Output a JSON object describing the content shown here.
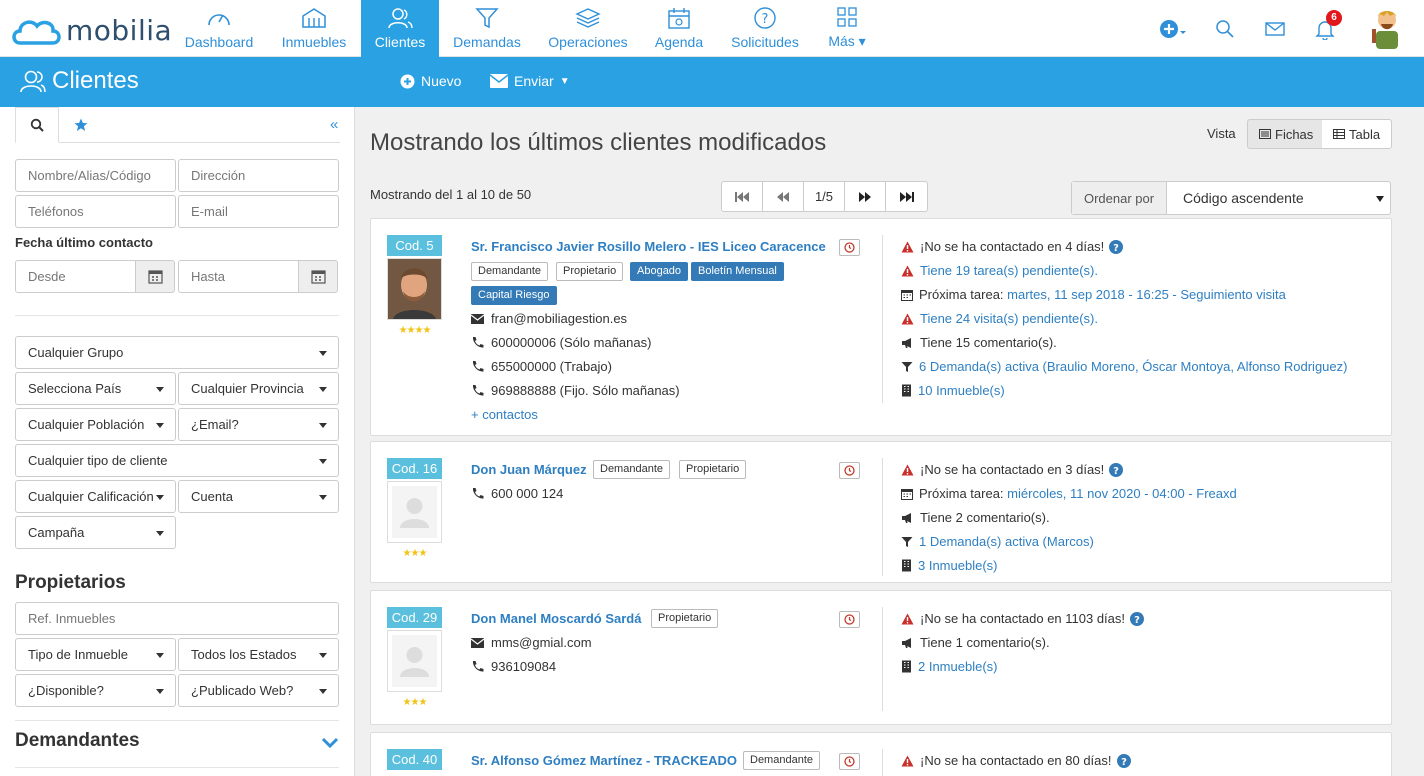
{
  "app": {
    "logo_text": "mobilia",
    "notification_count": "6"
  },
  "nav": [
    {
      "label": "Dashboard"
    },
    {
      "label": "Inmuebles"
    },
    {
      "label": "Clientes"
    },
    {
      "label": "Demandas"
    },
    {
      "label": "Operaciones"
    },
    {
      "label": "Agenda"
    },
    {
      "label": "Solicitudes"
    },
    {
      "label": "Más"
    }
  ],
  "header": {
    "title": "Clientes",
    "new_label": "Nuevo",
    "send_label": "Enviar"
  },
  "sidebar": {
    "name_placeholder": "Nombre/Alias/Código",
    "address_placeholder": "Dirección",
    "phones_placeholder": "Teléfonos",
    "email_placeholder": "E-mail",
    "last_contact_label": "Fecha último contacto",
    "from_placeholder": "Desde",
    "to_placeholder": "Hasta",
    "group": "Cualquier Grupo",
    "country": "Selecciona País",
    "province": "Cualquier Provincia",
    "town": "Cualquier Población",
    "email_q": "¿Email?",
    "client_type": "Cualquier tipo de cliente",
    "rating": "Cualquier Calificación",
    "account": "Cuenta",
    "campaign": "Campaña",
    "owners_title": "Propietarios",
    "ref_placeholder": "Ref. Inmuebles",
    "property_type": "Tipo de Inmueble",
    "states": "Todos los Estados",
    "available": "¿Disponible?",
    "published": "¿Publicado Web?",
    "demanders_title": "Demandantes"
  },
  "main": {
    "title": "Mostrando los últimos clientes modificados",
    "vista_label": "Vista",
    "view_cards": "Fichas",
    "view_table": "Tabla",
    "showing": "Mostrando del 1 al 10 de 50",
    "page": "1/5",
    "sort_label": "Ordenar por",
    "sort_value": "Código ascendente"
  },
  "clients": [
    {
      "code": "Cod. 5",
      "name": "Sr. Francisco Javier Rosillo Melero - IES Liceo Caracence",
      "stars": "★★★★",
      "tags": [
        "Demandante",
        "Propietario",
        "Abogado",
        "Boletín Mensual",
        "Capital Riesgo"
      ],
      "email": "fran@mobiliagestion.es",
      "phones": [
        "600000006 (Sólo mañanas)",
        "655000000 (Trabajo)",
        "969888888 (Fijo. Sólo mañanas)"
      ],
      "more_contacts": "+ contactos",
      "no_contact": "¡No se ha contactado en 4 días!",
      "tasks": "Tiene 19 tarea(s) pendiente(s).",
      "next_task_label": "Próxima tarea:",
      "next_task": "martes, 11 sep 2018 - 16:25 - Seguimiento visita",
      "visits": "Tiene 24 visita(s) pendiente(s).",
      "comments": "Tiene 15 comentario(s).",
      "demands": "6 Demanda(s) activa (Braulio Moreno, Óscar Montoya, Alfonso Rodriguez)",
      "properties": "10 Inmueble(s)"
    },
    {
      "code": "Cod. 16",
      "name": "Don Juan Márquez",
      "stars": "★★★",
      "tags": [
        "Demandante",
        "Propietario"
      ],
      "phones": [
        "600 000 124"
      ],
      "no_contact": "¡No se ha contactado en 3 días!",
      "next_task_label": "Próxima tarea:",
      "next_task": "miércoles, 11 nov 2020 - 04:00 - Freaxd",
      "comments": "Tiene 2 comentario(s).",
      "demands": "1 Demanda(s) activa (Marcos)",
      "properties": "3 Inmueble(s)"
    },
    {
      "code": "Cod. 29",
      "name": "Don Manel Moscardó Sardá",
      "stars": "★★★",
      "tags": [
        "Propietario"
      ],
      "email": "mms@gmial.com",
      "phones": [
        "936109084"
      ],
      "no_contact": "¡No se ha contactado en 1103 días!",
      "comments": "Tiene 1 comentario(s).",
      "properties": "2 Inmueble(s)"
    },
    {
      "code": "Cod. 40",
      "name": "Sr. Alfonso Gómez Martínez - TRACKEADO",
      "tags": [
        "Demandante"
      ],
      "no_contact": "¡No se ha contactado en 80 días!"
    }
  ]
}
